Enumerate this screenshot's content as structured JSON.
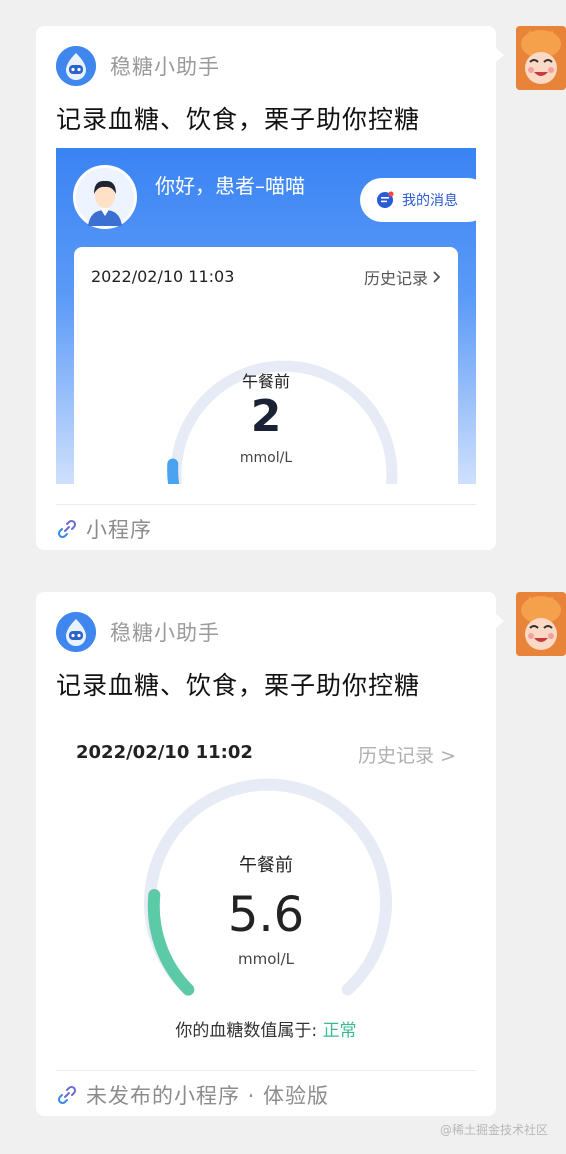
{
  "watermark": "@稀土掘金技术社区",
  "cards": [
    {
      "app_name": "稳糖小助手",
      "title": "记录血糖、饮食，栗子助你控糖",
      "preview": {
        "greeting": "你好，患者–喵喵",
        "messages_label": "我的消息",
        "date": "2022/02/10 11:03",
        "history_label": "历史记录",
        "meal_label": "午餐前",
        "value": "2",
        "unit": "mmol/L"
      },
      "footer_label": "小程序"
    },
    {
      "app_name": "稳糖小助手",
      "title": "记录血糖、饮食，栗子助你控糖",
      "preview": {
        "date": "2022/02/10 11:02",
        "history_label": "历史记录 >",
        "meal_label": "午餐前",
        "value": "5.6",
        "unit": "mmol/L",
        "status_prefix": "你的血糖数值属于:",
        "status_value": "正常"
      },
      "footer_label": "未发布的小程序 · 体验版"
    }
  ],
  "colors": {
    "brand_blue": "#3f86ef",
    "normal_green": "#3ab88f",
    "gauge_track": "#e6ebf5",
    "low_blue": "#4aa3f0",
    "avatar_orange": "#e8833a"
  },
  "icons": {
    "app_logo": "robot-drop-icon",
    "mini_program": "link-icon",
    "messages": "message-icon",
    "history_arrow": "chevron-right-icon",
    "user_avatar": "user-avatar-icon"
  }
}
